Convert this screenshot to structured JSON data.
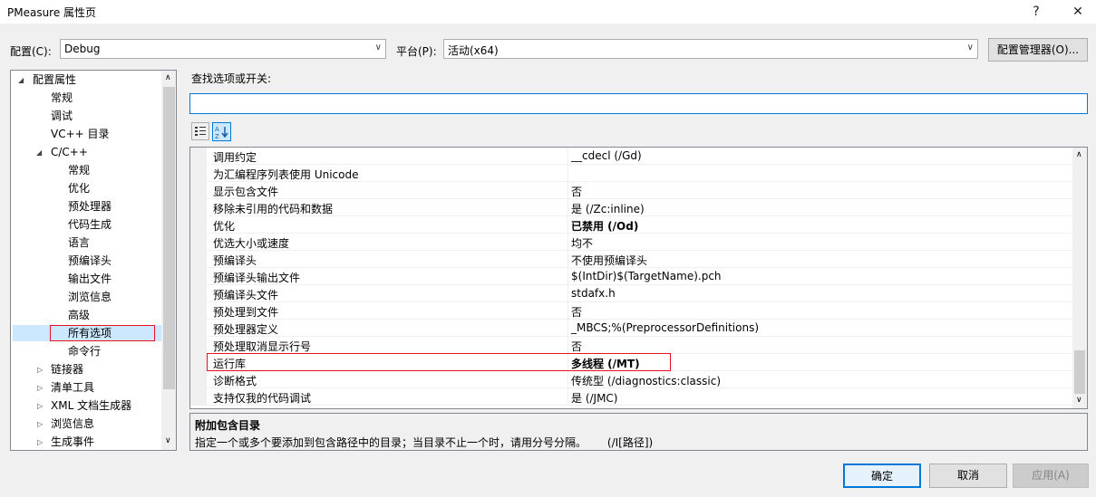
{
  "window": {
    "title": "PMeasure 属性页",
    "help_glyph": "?",
    "close_glyph": "✕"
  },
  "config": {
    "label": "配置(C):",
    "value": "Debug"
  },
  "platform": {
    "label": "平台(P):",
    "value": "活动(x64)"
  },
  "config_manager_label": "配置管理器(O)...",
  "search": {
    "label": "查找选项或开关:",
    "value": ""
  },
  "tree": {
    "root": "配置属性",
    "items": [
      "常规",
      "调试",
      "VC++ 目录"
    ],
    "cpp": "C/C++",
    "cpp_items": [
      "常规",
      "优化",
      "预处理器",
      "代码生成",
      "语言",
      "预编译头",
      "输出文件",
      "浏览信息",
      "高级",
      "所有选项",
      "命令行"
    ],
    "tail": [
      "链接器",
      "清单工具",
      "XML 文档生成器",
      "浏览信息",
      "生成事件"
    ],
    "selected": "所有选项"
  },
  "grid": {
    "rows": [
      {
        "name": "调用约定",
        "value": "__cdecl (/Gd)",
        "bold": false
      },
      {
        "name": "为汇编程序列表使用 Unicode",
        "value": "",
        "bold": false
      },
      {
        "name": "显示包含文件",
        "value": "否",
        "bold": false
      },
      {
        "name": "移除未引用的代码和数据",
        "value": "是 (/Zc:inline)",
        "bold": false
      },
      {
        "name": "优化",
        "value": "已禁用 (/Od)",
        "bold": true
      },
      {
        "name": "优选大小或速度",
        "value": "均不",
        "bold": false
      },
      {
        "name": "预编译头",
        "value": "不使用预编译头",
        "bold": false
      },
      {
        "name": "预编译头输出文件",
        "value": "$(IntDir)$(TargetName).pch",
        "bold": false
      },
      {
        "name": "预编译头文件",
        "value": "stdafx.h",
        "bold": false
      },
      {
        "name": "预处理到文件",
        "value": "否",
        "bold": false
      },
      {
        "name": "预处理器定义",
        "value": "_MBCS;%(PreprocessorDefinitions)",
        "bold": false
      },
      {
        "name": "预处理取消显示行号",
        "value": "否",
        "bold": false
      },
      {
        "name": "运行库",
        "value": "多线程 (/MT)",
        "bold": true
      },
      {
        "name": "诊断格式",
        "value": "传统型 (/diagnostics:classic)",
        "bold": false
      },
      {
        "name": "支持仅我的代码调试",
        "value": "是 (/JMC)",
        "bold": false
      }
    ]
  },
  "description": {
    "title": "附加包含目录",
    "text": "指定一个或多个要添加到包含路径中的目录；当目录不止一个时，请用分号分隔。      (/I[路径])"
  },
  "buttons": {
    "ok": "确定",
    "cancel": "取消",
    "apply": "应用(A)"
  },
  "colors": {
    "highlight_box": "#e81123",
    "selected_bg": "#cce8ff",
    "ok_border": "#0078d7"
  }
}
